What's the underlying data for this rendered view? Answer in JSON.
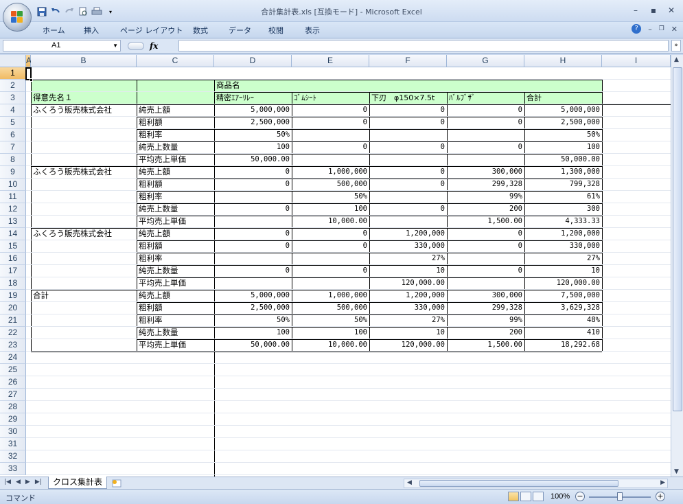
{
  "window": {
    "title": "合計集計表.xls  [互換モード] - Microsoft Excel"
  },
  "ribbon": {
    "tabs": [
      "ホーム",
      "挿入",
      "ページ レイアウト",
      "数式",
      "データ",
      "校閲",
      "表示"
    ]
  },
  "formula_bar": {
    "name_box": "A1",
    "fx": "fx",
    "content": ""
  },
  "columns": [
    "A",
    "B",
    "C",
    "D",
    "E",
    "F",
    "G",
    "H",
    "I"
  ],
  "rows": [
    "1",
    "2",
    "3",
    "4",
    "5",
    "6",
    "7",
    "8",
    "9",
    "10",
    "11",
    "12",
    "13",
    "14",
    "15",
    "16",
    "17",
    "18",
    "19",
    "20",
    "21",
    "22",
    "23",
    "24",
    "25",
    "26",
    "27",
    "28",
    "29",
    "30",
    "31",
    "32",
    "33"
  ],
  "table": {
    "header_product": "商品名",
    "header_customer": "得意先名１",
    "products": [
      "精密ｴｱｰﾘﾚｰ",
      "ｺﾞﾑｼｰﾄ",
      "下刃　φ150×7.5t",
      "ﾊﾞﾙﾌﾞｻﾞ",
      "合計"
    ],
    "rows": [
      [
        "ふくろう販売株式会社",
        "純売上額",
        "5,000,000",
        "0",
        "0",
        "0",
        "5,000,000"
      ],
      [
        "",
        "粗利額",
        "2,500,000",
        "0",
        "0",
        "0",
        "2,500,000"
      ],
      [
        "",
        "粗利率",
        "50%",
        "",
        "",
        "",
        "50%"
      ],
      [
        "",
        "純売上数量",
        "100",
        "0",
        "0",
        "0",
        "100"
      ],
      [
        "",
        "平均売上単価",
        "50,000.00",
        "",
        "",
        "",
        "50,000.00"
      ],
      [
        "ふくろう販売株式会社",
        "純売上額",
        "0",
        "1,000,000",
        "0",
        "300,000",
        "1,300,000"
      ],
      [
        "",
        "粗利額",
        "0",
        "500,000",
        "0",
        "299,328",
        "799,328"
      ],
      [
        "",
        "粗利率",
        "",
        "50%",
        "",
        "99%",
        "61%"
      ],
      [
        "",
        "純売上数量",
        "0",
        "100",
        "0",
        "200",
        "300"
      ],
      [
        "",
        "平均売上単価",
        "",
        "10,000.00",
        "",
        "1,500.00",
        "4,333.33"
      ],
      [
        "ふくろう販売株式会社",
        "純売上額",
        "0",
        "0",
        "1,200,000",
        "0",
        "1,200,000"
      ],
      [
        "",
        "粗利額",
        "0",
        "0",
        "330,000",
        "0",
        "330,000"
      ],
      [
        "",
        "粗利率",
        "",
        "",
        "27%",
        "",
        "27%"
      ],
      [
        "",
        "純売上数量",
        "0",
        "0",
        "10",
        "0",
        "10"
      ],
      [
        "",
        "平均売上単価",
        "",
        "",
        "120,000.00",
        "",
        "120,000.00"
      ],
      [
        "合計",
        "純売上額",
        "5,000,000",
        "1,000,000",
        "1,200,000",
        "300,000",
        "7,500,000"
      ],
      [
        "",
        "粗利額",
        "2,500,000",
        "500,000",
        "330,000",
        "299,328",
        "3,629,328"
      ],
      [
        "",
        "粗利率",
        "50%",
        "50%",
        "27%",
        "99%",
        "48%"
      ],
      [
        "",
        "純売上数量",
        "100",
        "100",
        "10",
        "200",
        "410"
      ],
      [
        "",
        "平均売上単価",
        "50,000.00",
        "10,000.00",
        "120,000.00",
        "1,500.00",
        "18,292.68"
      ]
    ]
  },
  "sheets": {
    "active": "クロス集計表"
  },
  "status": {
    "mode": "コマンド",
    "zoom": "100%"
  },
  "colors": {
    "header_fill": "#ccffcc",
    "select": "#f5c46a"
  }
}
